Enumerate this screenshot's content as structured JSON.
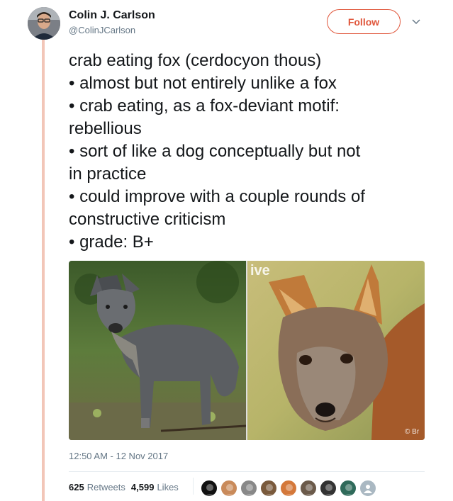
{
  "author": {
    "display_name": "Colin J. Carlson",
    "screen_name": "@ColinJCarlson",
    "avatar_icon": "user-avatar"
  },
  "follow_button": {
    "label": "Follow"
  },
  "menu_icon": "chevron-down-icon",
  "tweet": {
    "lines": [
      "crab eating fox (cerdocyon thous)",
      "• almost but not entirely unlike a fox",
      "• crab eating, as a fox-deviant motif:",
      "rebellious",
      "• sort of like a dog conceptually but not",
      "in practice",
      "• could improve with a couple rounds of",
      "constructive criticism",
      "• grade: B+"
    ]
  },
  "media": {
    "left_photo": "crab-eating-fox-standing-photo",
    "right_photo": "crab-eating-fox-closeup-photo",
    "right_watermark": "ive",
    "right_credit": "© Br"
  },
  "timestamp": "12:50 AM - 12 Nov 2017",
  "stats": {
    "retweets_count": "625",
    "retweets_label": "Retweets",
    "likes_count": "4,599",
    "likes_label": "Likes"
  },
  "likers": [
    {
      "color": "#111111"
    },
    {
      "color": "#c98a5a"
    },
    {
      "color": "#888888"
    },
    {
      "color": "#7a5a3c"
    },
    {
      "color": "#d4783a"
    },
    {
      "color": "#6b5a4a"
    },
    {
      "color": "#333333"
    },
    {
      "color": "#2f6a5a"
    },
    {
      "color": "#aab8c2"
    }
  ],
  "colors": {
    "accent": "#e0563b",
    "thread_line": "#f2c6b8",
    "muted_text": "#657786"
  }
}
